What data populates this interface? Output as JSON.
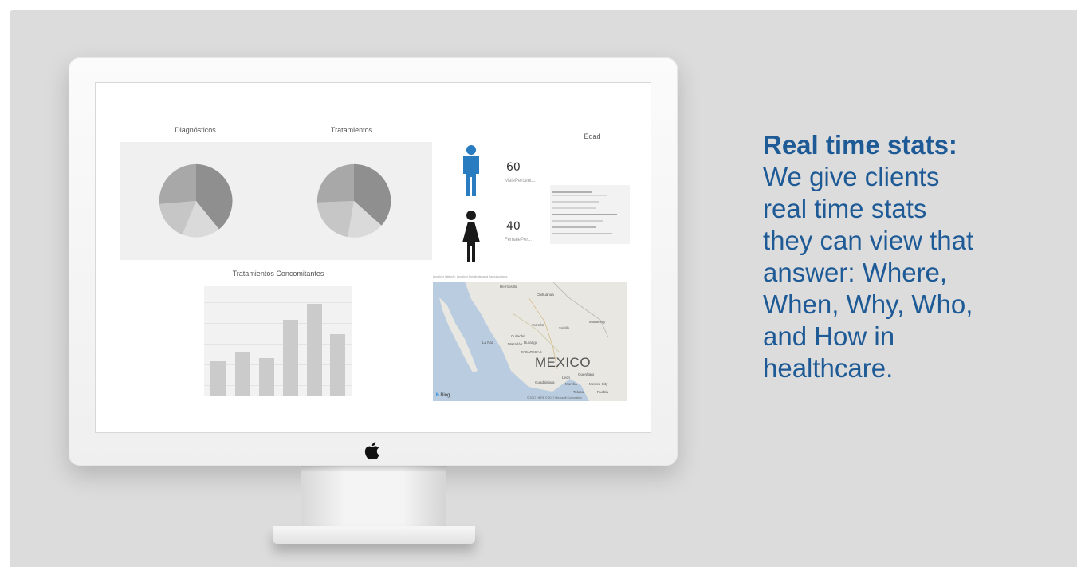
{
  "caption": {
    "heading": "Real time stats:",
    "lines": [
      "We give clients",
      "real time stats",
      "they can view that",
      "answer: Where,",
      "When, Why, Who,",
      "and How in",
      "healthcare."
    ]
  },
  "dashboard": {
    "pie1_title": "Diagnósticos",
    "pie2_title": "Tratamientos",
    "edad_title": "Edad",
    "male": {
      "value": "60",
      "label": "MalePercent..."
    },
    "female": {
      "value": "40",
      "label": "FemalePer..."
    },
    "bar_title": "Tratamientos Concomitantes",
    "map": {
      "header": "location latitude, location longitude and Asociaciones",
      "country": "MEXICO",
      "cities": [
        "Hermosillo",
        "Chihuahua",
        "Torreón",
        "Saltillo",
        "Monterrey",
        "Culiacán",
        "Durango",
        "La Paz",
        "Mazatlán",
        "ZACATECAS",
        "Querétaro",
        "León",
        "Guadalajara",
        "Morelia",
        "Mexico City",
        "Toluca",
        "Puebla"
      ],
      "attribution": "Bing",
      "copyright": "© 2017 HERE © 2017 Microsoft Corporation"
    },
    "colors": {
      "male": "#2a7cc0",
      "female": "#1a1a1a"
    }
  }
}
